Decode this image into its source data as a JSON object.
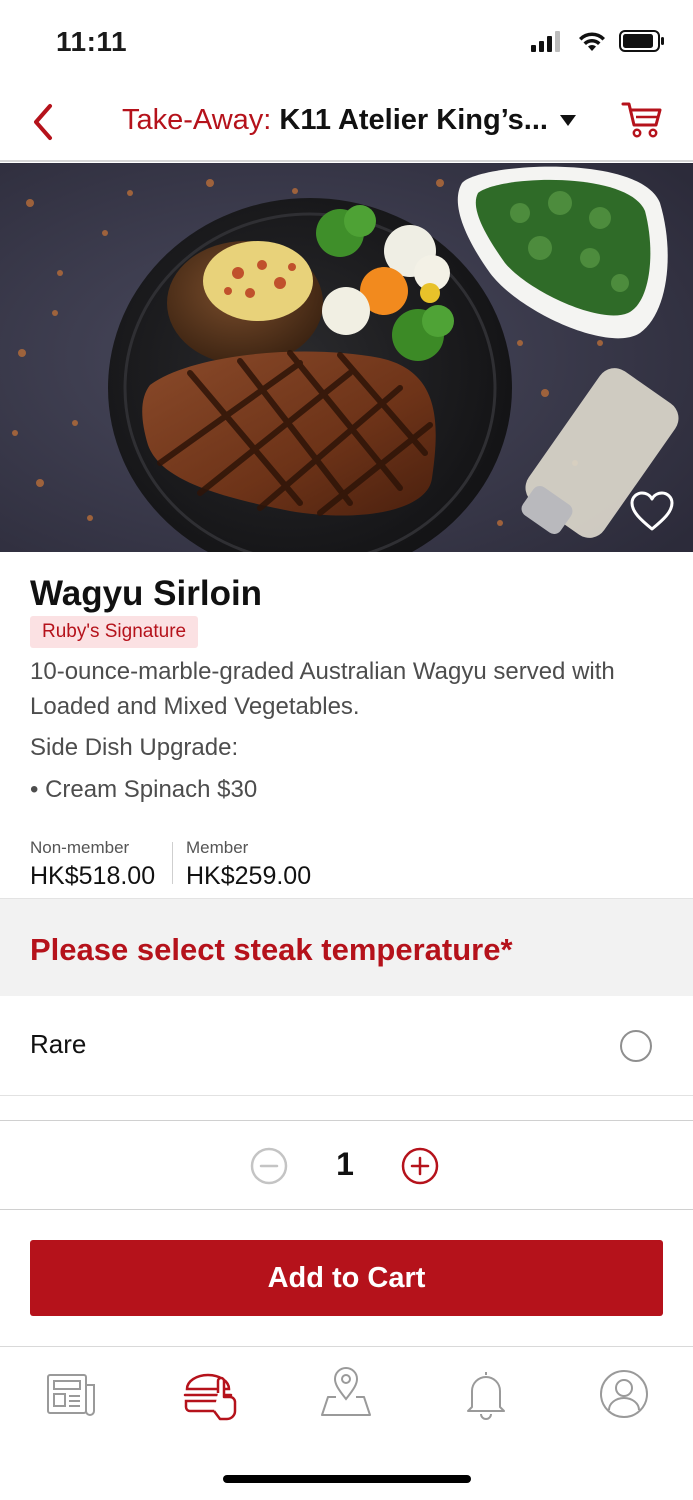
{
  "status": {
    "time": "11:11",
    "icons": [
      "cellular-signal-icon",
      "wifi-icon",
      "battery-icon"
    ]
  },
  "nav": {
    "back_icon": "chevron-left-icon",
    "prefix": "Take-Away:",
    "store": "K11 Atelier King’s...",
    "dropdown_icon": "caret-down-icon",
    "cart_icon": "cart-icon"
  },
  "hero": {
    "image_description": "Grilled steak with baked potato and vegetables on a black plate",
    "favorite_icon": "heart-outline-icon"
  },
  "product": {
    "name": "Wagyu Sirloin",
    "badge": "Ruby's Signature",
    "description": "10-ounce-marble-graded Australian Wagyu served with Loaded and Mixed Vegetables.",
    "upgrade_label": "Side Dish Upgrade:",
    "upgrade_item": "• Cream Spinach $30",
    "prices": {
      "nonmember_label": "Non-member",
      "nonmember_value": "HK$518.00",
      "member_label": "Member",
      "member_value": "HK$259.00"
    }
  },
  "temperature": {
    "title": "Please select steak temperature*",
    "options": [
      {
        "label": "Rare",
        "selected": false
      }
    ]
  },
  "quantity": {
    "value": "1",
    "minus_icon": "minus-circle-icon",
    "plus_icon": "plus-circle-icon"
  },
  "add_to_cart": {
    "label": "Add to Cart"
  },
  "tabs": [
    {
      "icon": "newspaper-icon",
      "active": false
    },
    {
      "icon": "burger-hand-icon",
      "active": true
    },
    {
      "icon": "map-pin-icon",
      "active": false
    },
    {
      "icon": "bell-icon",
      "active": false
    },
    {
      "icon": "profile-icon",
      "active": false
    }
  ],
  "colors": {
    "brand_red": "#b5121b",
    "badge_bg": "#fbe1e3",
    "section_bg": "#f2f2f2",
    "inactive_icon": "#9a9a9a"
  }
}
